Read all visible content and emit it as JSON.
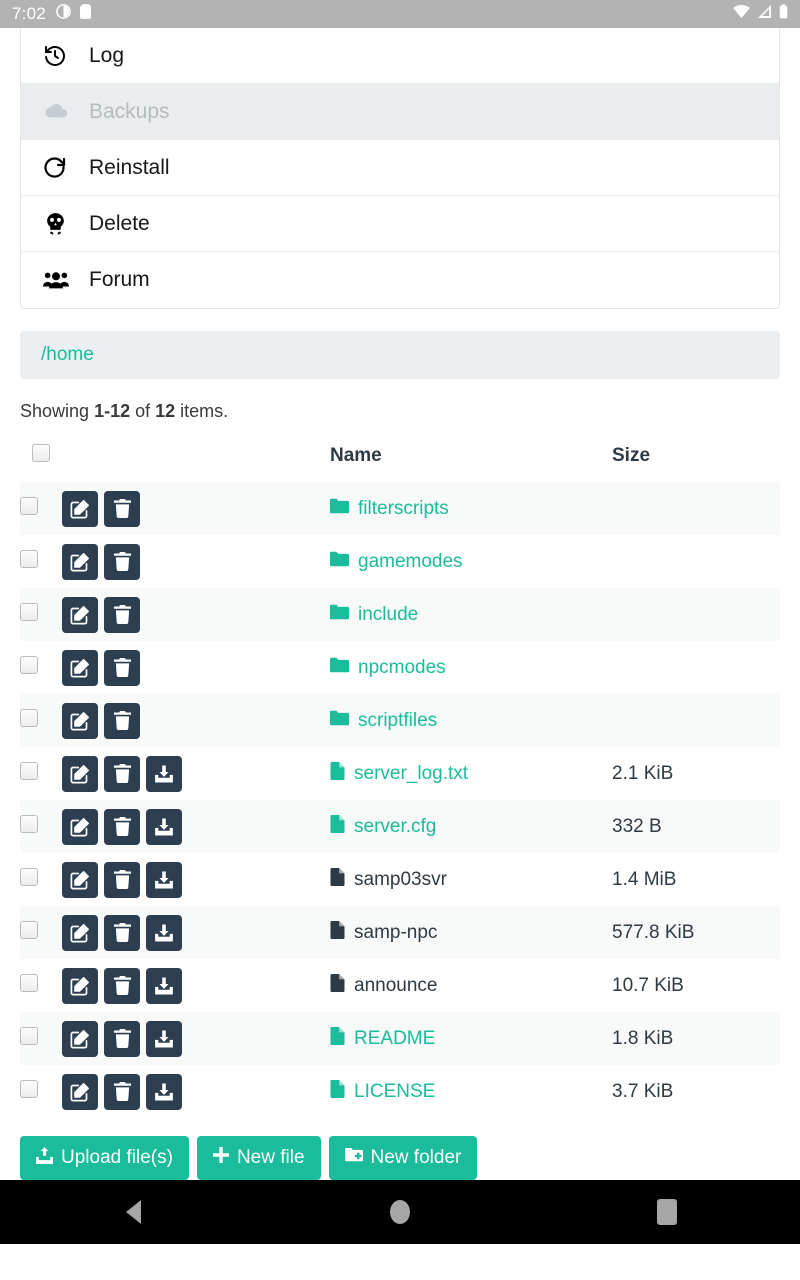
{
  "status_bar": {
    "time": "7:02",
    "left_icons": [
      "screen-record-icon",
      "sd-card-icon"
    ],
    "right_icons": [
      "wifi-icon",
      "cell-signal-icon",
      "battery-icon"
    ]
  },
  "menu": {
    "items": [
      {
        "label": "Log",
        "icon": "history-icon",
        "disabled": false
      },
      {
        "label": "Backups",
        "icon": "cloud-icon",
        "disabled": true
      },
      {
        "label": "Reinstall",
        "icon": "refresh-icon",
        "disabled": false
      },
      {
        "label": "Delete",
        "icon": "skull-icon",
        "disabled": false
      },
      {
        "label": "Forum",
        "icon": "users-icon",
        "disabled": false
      }
    ]
  },
  "breadcrumb": {
    "path": "/home"
  },
  "listing": {
    "showing_prefix": "Showing ",
    "showing_range": "1-12",
    "showing_middle": " of ",
    "showing_total": "12",
    "showing_suffix": " items."
  },
  "table": {
    "headers": {
      "name": "Name",
      "size": "Size"
    },
    "rows": [
      {
        "name": "filterscripts",
        "size": "",
        "kind": "folder",
        "teal": true,
        "download": false
      },
      {
        "name": "gamemodes",
        "size": "",
        "kind": "folder",
        "teal": true,
        "download": false
      },
      {
        "name": "include",
        "size": "",
        "kind": "folder",
        "teal": true,
        "download": false
      },
      {
        "name": "npcmodes",
        "size": "",
        "kind": "folder",
        "teal": true,
        "download": false
      },
      {
        "name": "scriptfiles",
        "size": "",
        "kind": "folder",
        "teal": true,
        "download": false
      },
      {
        "name": "server_log.txt",
        "size": "2.1 KiB",
        "kind": "file",
        "teal": true,
        "download": true
      },
      {
        "name": "server.cfg",
        "size": "332 B",
        "kind": "file",
        "teal": true,
        "download": true
      },
      {
        "name": "samp03svr",
        "size": "1.4 MiB",
        "kind": "file",
        "teal": false,
        "download": true
      },
      {
        "name": "samp-npc",
        "size": "577.8 KiB",
        "kind": "file",
        "teal": false,
        "download": true
      },
      {
        "name": "announce",
        "size": "10.7 KiB",
        "kind": "file",
        "teal": false,
        "download": true
      },
      {
        "name": "README",
        "size": "1.8 KiB",
        "kind": "file",
        "teal": true,
        "download": true
      },
      {
        "name": "LICENSE",
        "size": "3.7 KiB",
        "kind": "file",
        "teal": true,
        "download": true
      }
    ],
    "row_action_icons": [
      "edit-icon",
      "trash-icon",
      "download-icon"
    ]
  },
  "bottom_buttons": [
    {
      "label": "Upload file(s)",
      "icon": "upload-icon"
    },
    {
      "label": "New file",
      "icon": "plus-icon"
    },
    {
      "label": "New folder",
      "icon": "folder-plus-icon"
    }
  ],
  "nav_bar": {
    "back": "back-button",
    "home": "home-button",
    "recents": "recents-button"
  },
  "colors": {
    "accent_teal": "#1abc9c",
    "dark_navy": "#2d3e50",
    "status_bar": "#b3b3b3",
    "row_stripe": "#f8f9f9",
    "breadcrumb_bg": "#eceff1"
  }
}
